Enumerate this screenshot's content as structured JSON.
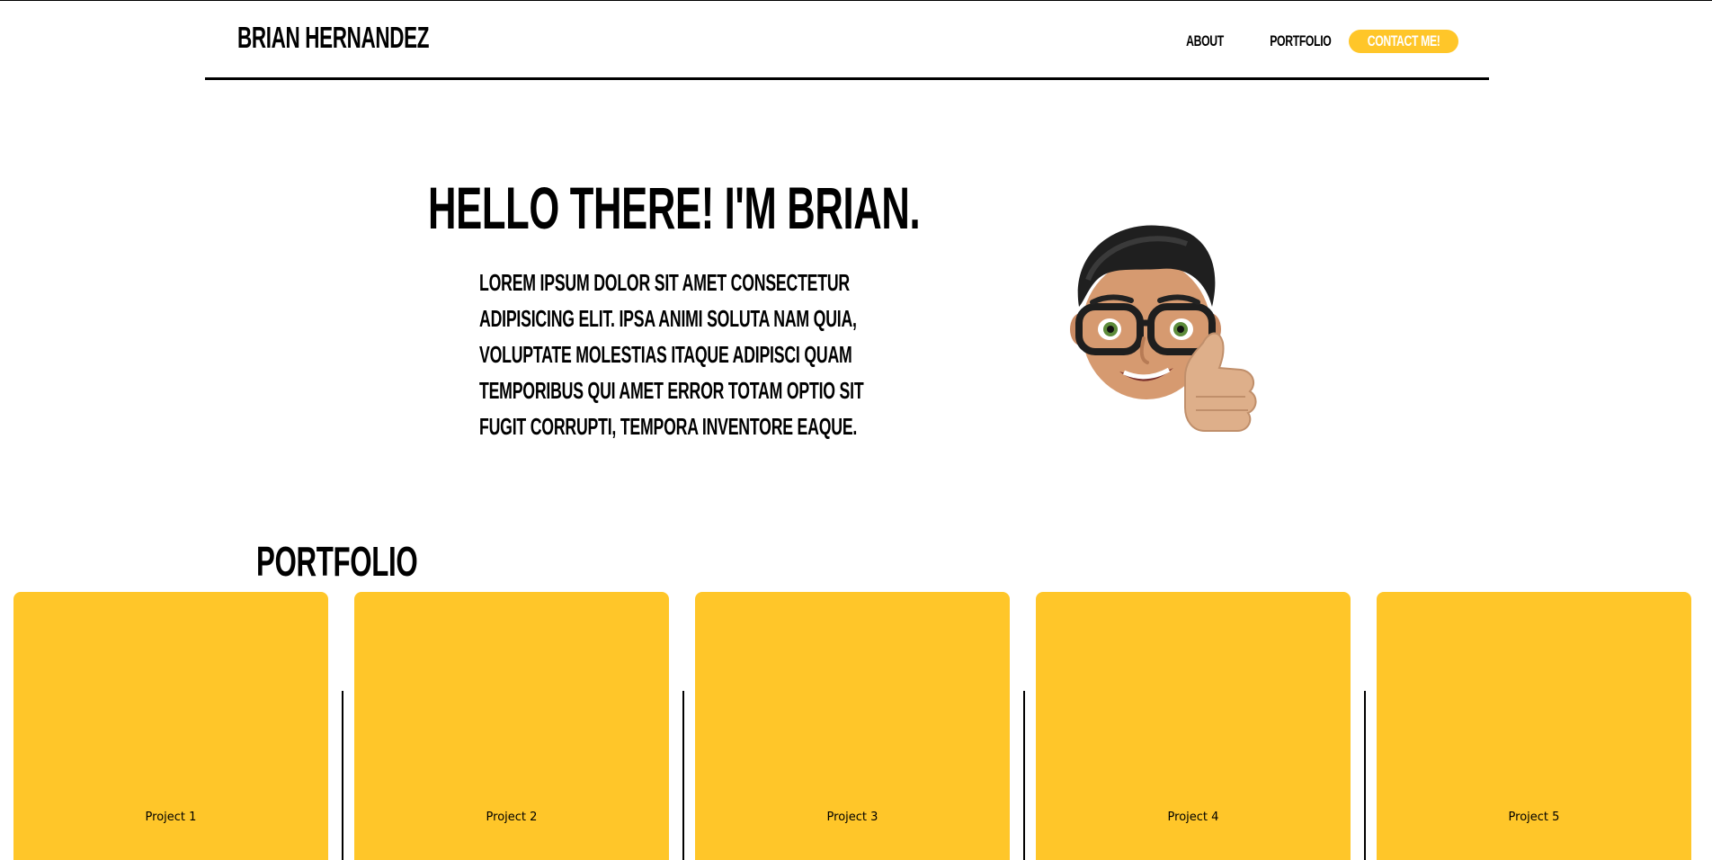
{
  "header": {
    "brand": "BRIAN HERNANDEZ",
    "nav": {
      "about": "ABOUT",
      "portfolio": "PORTFOLIO",
      "contact": "CONTACT ME!"
    }
  },
  "hero": {
    "title": "HELLO THERE! I'M BRIAN.",
    "lines": [
      "LOREM IPSUM DOLOR SIT AMET CONSECTETUR",
      "ADIPISICING ELIT. IPSA ANIMI SOLUTA NAM QUIA,",
      "VOLUPTATE MOLESTIAS ITAQUE ADIPISCI QUAM",
      "TEMPORIBUS QUI AMET ERROR TOTAM OPTIO SIT",
      "FUGIT CORRUPTI, TEMPORA INVENTORE EAQUE."
    ],
    "avatar_icon": "memoji-thumbs-up-avatar"
  },
  "portfolio": {
    "title": "PORTFOLIO",
    "projects": [
      {
        "label": "Project 1"
      },
      {
        "label": "Project 2"
      },
      {
        "label": "Project 3"
      },
      {
        "label": "Project 4"
      },
      {
        "label": "Project 5"
      }
    ]
  },
  "colors": {
    "accent": "#ffc629",
    "text": "#000000",
    "background": "#ffffff"
  }
}
